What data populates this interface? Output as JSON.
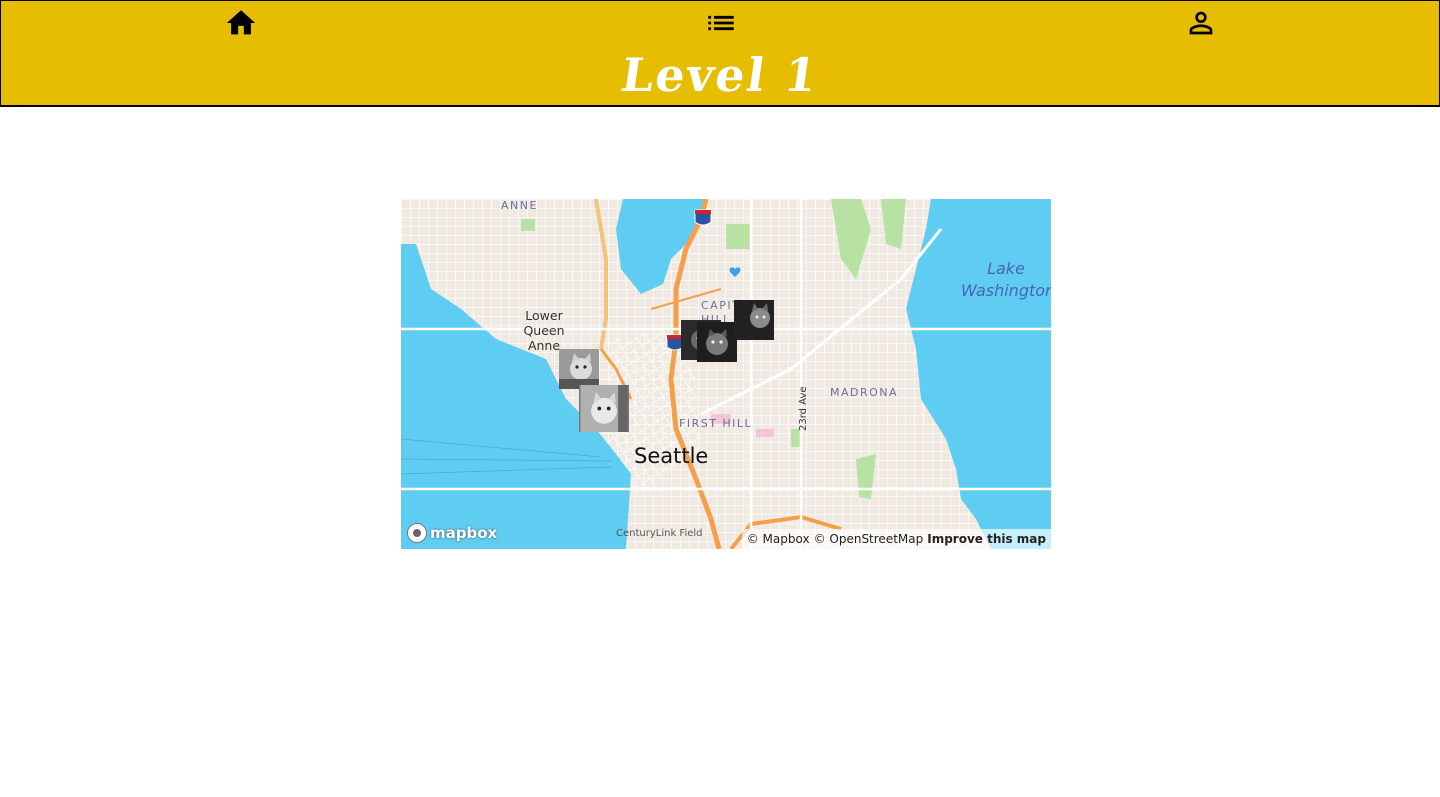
{
  "nav": {
    "home_icon": "home-icon",
    "list_icon": "list-icon",
    "profile_icon": "person-icon"
  },
  "header": {
    "title": "Level 1"
  },
  "map": {
    "labels": {
      "anne": "ANNE",
      "lake": "Lake Washington",
      "lower_queen_anne": "Lower Queen Anne",
      "capitol_hill": "CAPITOL HILL",
      "madrona": "MADRONA",
      "first_hill": "FIRST HILL",
      "street_23rd": "23rd Ave",
      "city": "Seattle",
      "centurylink": "CenturyLink Field",
      "i5_shield": "5"
    },
    "markers": [
      "cat-photo-marker",
      "cat-photo-marker",
      "cat-photo-marker",
      "cat-photo-marker",
      "cat-photo-marker"
    ],
    "logo": "mapbox",
    "attribution": {
      "mapbox": "© Mapbox",
      "osm": "© OpenStreetMap",
      "improve": "Improve this map"
    }
  },
  "colors": {
    "accent": "#e6bd00",
    "water": "#5fcdf2",
    "land": "#efe9e1",
    "highway": "#f4a04a",
    "park": "#b8e2a3"
  }
}
